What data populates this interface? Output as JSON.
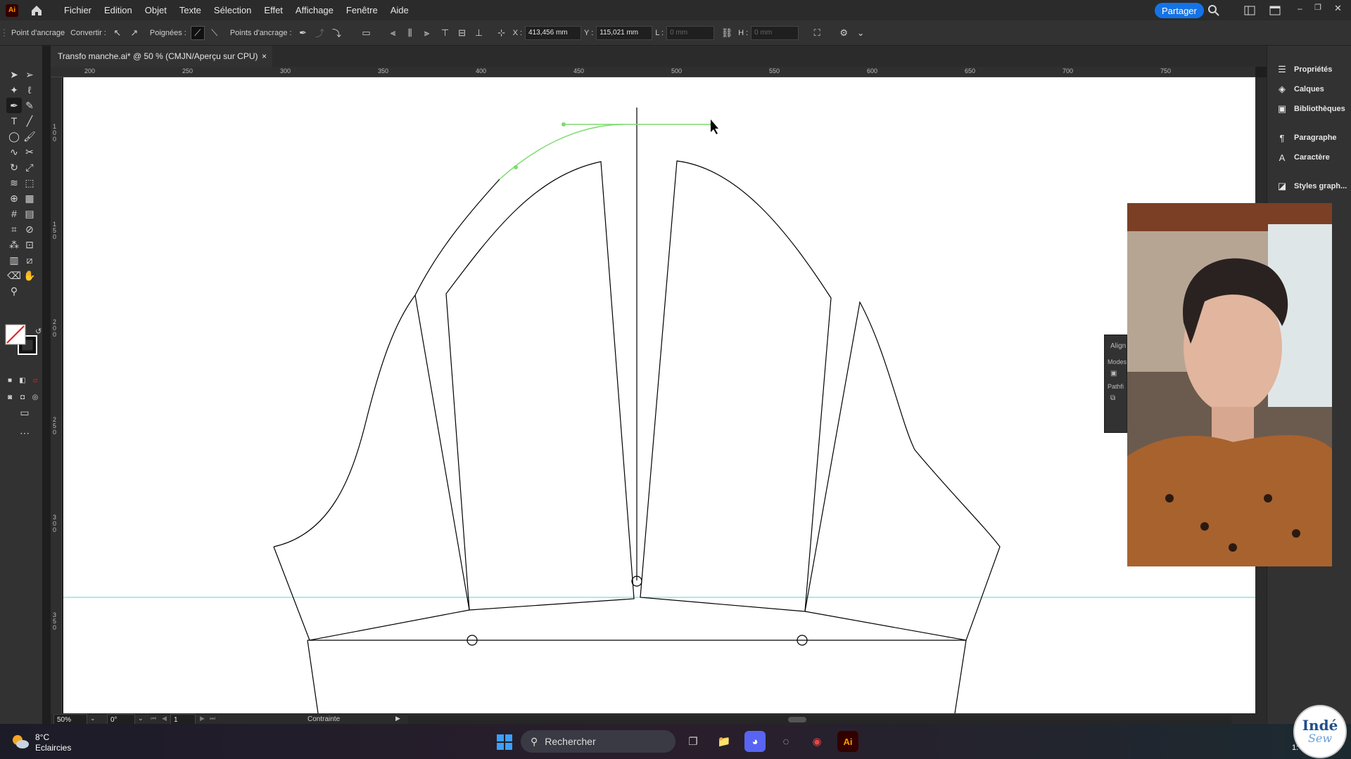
{
  "app": {
    "logo_text": "Ai",
    "menu": [
      "Fichier",
      "Edition",
      "Objet",
      "Texte",
      "Sélection",
      "Effet",
      "Affichage",
      "Fenêtre",
      "Aide"
    ],
    "share_label": "Partager"
  },
  "controlbar": {
    "anchor_point_label": "Point d'ancrage",
    "convert_label": "Convertir :",
    "handles_label": "Poignées :",
    "anchor_points_label": "Points d'ancrage :",
    "x_label": "X :",
    "x_value": "413,456 mm",
    "y_label": "Y :",
    "y_value": "115,021 mm",
    "w_label": "L :",
    "w_value": "0 mm",
    "h_label": "H :",
    "h_value": "0 mm"
  },
  "document": {
    "tab_title": "Transfo manche.ai* @ 50 % (CMJN/Aperçu sur CPU)",
    "close_glyph": "×"
  },
  "rulers": {
    "top_ticks": [
      "200",
      "250",
      "300",
      "350",
      "400",
      "450",
      "500",
      "550",
      "600",
      "650",
      "700",
      "750"
    ],
    "left_ticks": [
      "100",
      "150",
      "200",
      "250",
      "300",
      "350"
    ]
  },
  "statusbar": {
    "zoom": "50%",
    "rotation": "0°",
    "artboard": "1",
    "mode": "Contrainte"
  },
  "right_panel": {
    "items": [
      {
        "label": "Propriétés",
        "icon": "properties-icon"
      },
      {
        "label": "Calques",
        "icon": "layers-icon"
      },
      {
        "label": "Bibliothèques",
        "icon": "libraries-icon"
      },
      {
        "label": "Paragraphe",
        "icon": "paragraph-icon"
      },
      {
        "label": "Caractère",
        "icon": "character-icon"
      },
      {
        "label": "Styles graph...",
        "icon": "graphic-styles-icon"
      }
    ]
  },
  "align_panel": {
    "title": "Align",
    "modes_label": "Modes",
    "pathfinder_label": "Pathfi"
  },
  "taskbar": {
    "temperature": "8°C",
    "weather": "Eclaircies",
    "search_placeholder": "Rechercher",
    "clock_partial": "1:"
  },
  "watermark": {
    "line1": "Indé",
    "line2": "Sew"
  },
  "colors": {
    "accent": "#1473e6",
    "guide": "#4dd8d8",
    "path_selected": "#7ddc6e",
    "canvas": "#ffffff"
  }
}
